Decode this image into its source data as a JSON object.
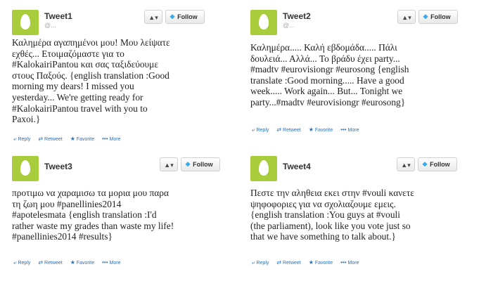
{
  "ui": {
    "follow_label": "Follow",
    "user_button_label": "▲▾",
    "actions": {
      "reply": "Reply",
      "retweet": "Retweet",
      "favorite": "Favorite",
      "more": "More"
    },
    "icons": {
      "reply": "reply-arrow-icon",
      "retweet": "retweet-icon",
      "favorite": "star-icon",
      "more": "more-dots-icon",
      "bird": "twitter-bird-icon",
      "user": "user-add-icon"
    },
    "colors": {
      "avatar": "#a9cc3c",
      "link": "#2a70b8",
      "bird": "#33aaee"
    }
  },
  "tweets": [
    {
      "name": "Tweet1",
      "handle": "@...",
      "lines": [
        "Καλημέρα αγαπημένοι μου! Μου λείψατε",
        "εχθές... Ετοιμαζόμαστε για το",
        "#KalokairiPantou και σας ταξιδεύουμε",
        "στους Παξούς. {english translation :Good",
        "morning my dears! I missed you",
        "yesterday... We're getting ready for",
        "#KalokairiPantou travel with you to",
        "Paxoi.}"
      ]
    },
    {
      "name": "Tweet2",
      "handle": "@...",
      "lines": [
        "Καλημέρα..... Καλή εβδομάδα..... Πάλι",
        "δουλειά... Αλλά... Το βράδυ έχει party...",
        "#madtv #eurovisiongr #eurosong {english",
        "translate :Good morning..... Have a good",
        "week..... Work again... But... Tonight we",
        "party...#madtv #eurovisiongr #eurosong}"
      ]
    },
    {
      "name": "Tweet3",
      "handle": "@...",
      "lines": [
        "προτιμω να χαραμισω τα μορια μου παρα",
        "τη ζωη μου #panellinies2014",
        "#apotelesmata {english translation :I'd",
        "rather waste my grades than waste my life!",
        "#panellinies2014 #results}"
      ]
    },
    {
      "name": "Tweet4",
      "handle": "@...",
      "lines": [
        "Πεστε την αληθεια εκει στην #vouli κανετε",
        "ψηφοφοριες για να σχολιαζουμε εμεις.",
        "{english translation :You guys at #vouli",
        "(the parliament), look like you vote just so",
        "that we have something to talk about.}"
      ]
    }
  ]
}
